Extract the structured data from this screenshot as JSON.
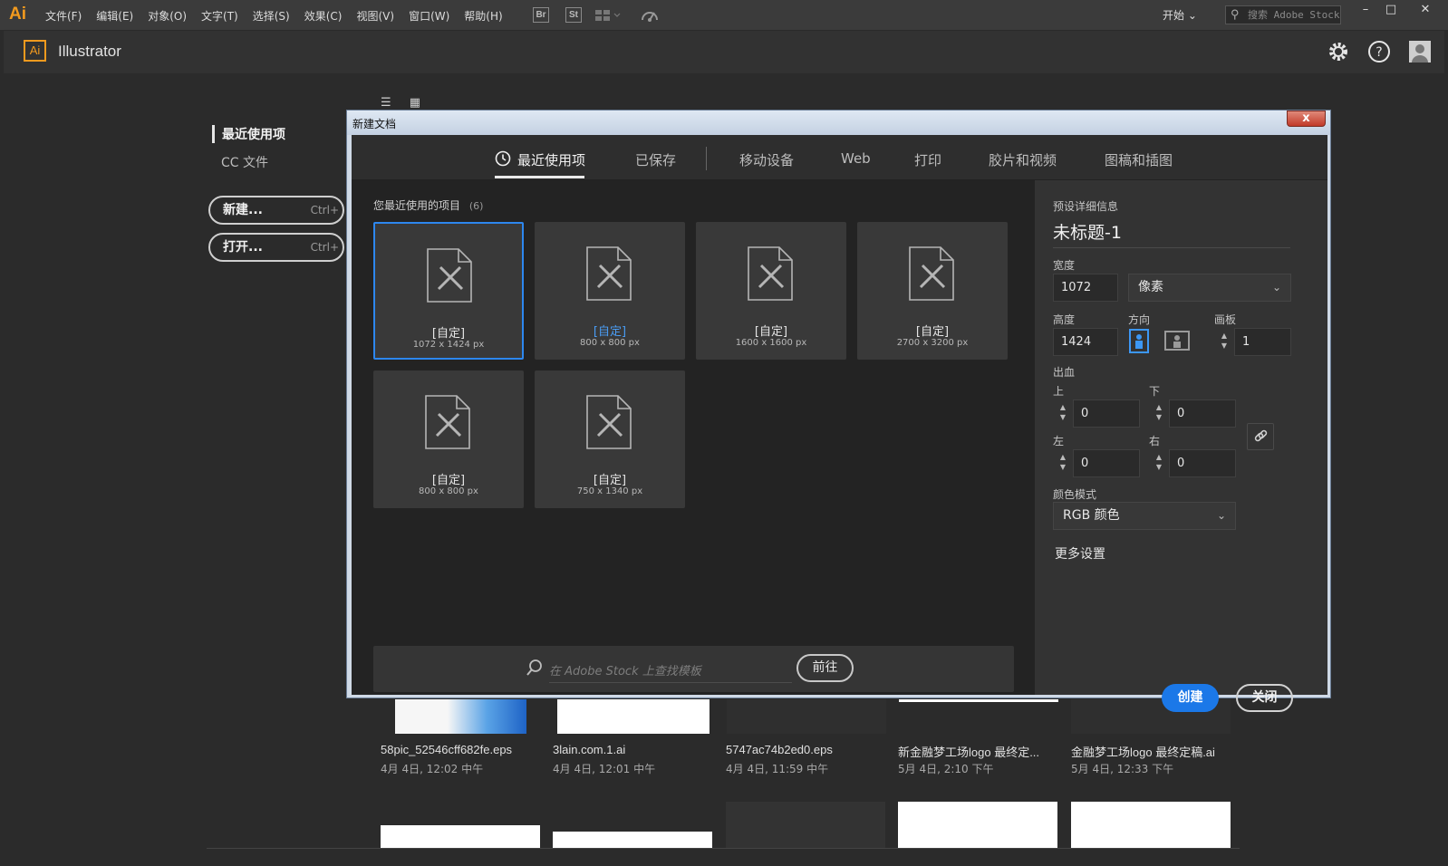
{
  "menubar": {
    "logo": "Ai",
    "items": [
      "文件(F)",
      "编辑(E)",
      "对象(O)",
      "文字(T)",
      "选择(S)",
      "效果(C)",
      "视图(V)",
      "窗口(W)",
      "帮助(H)"
    ],
    "bridge": "Br",
    "stock": "St",
    "workspace": "开始",
    "search_placeholder": "搜索 Adobe Stock"
  },
  "app": {
    "logo": "Ai",
    "name": "Illustrator"
  },
  "home": {
    "nav_recent": "最近使用项",
    "nav_cc": "CC 文件",
    "new_label": "新建...",
    "new_shortcut": "Ctrl+",
    "open_label": "打开...",
    "open_shortcut": "Ctrl+",
    "files": [
      {
        "name": "58pic_52546cff682fe.eps",
        "date": "4月 4日, 12:02 中午"
      },
      {
        "name": "3lain.com.1.ai",
        "date": "4月 4日, 12:01 中午"
      },
      {
        "name": "5747ac74b2ed0.eps",
        "date": "4月 4日, 11:59 中午"
      },
      {
        "name": "新金融梦工场logo 最终定...",
        "date": "5月 4日, 2:10 下午"
      },
      {
        "name": "金融梦工场logo 最终定稿.ai",
        "date": "5月 4日, 12:33 下午"
      }
    ]
  },
  "dialog": {
    "title": "新建文档",
    "close": "x",
    "tabs": [
      "最近使用项",
      "已保存",
      "移动设备",
      "Web",
      "打印",
      "胶片和视频",
      "图稿和插图"
    ],
    "recent_title": "您最近使用的项目",
    "recent_count": "(6)",
    "presets": [
      {
        "label": "[自定]",
        "size": "1072 x 1424 px"
      },
      {
        "label": "[自定]",
        "size": "800 x 800 px"
      },
      {
        "label": "[自定]",
        "size": "1600 x 1600 px"
      },
      {
        "label": "[自定]",
        "size": "2700 x 3200 px"
      },
      {
        "label": "[自定]",
        "size": "800 x 800 px"
      },
      {
        "label": "[自定]",
        "size": "750 x 1340 px"
      }
    ],
    "stock_placeholder": "在 Adobe Stock 上查找模板",
    "stock_go": "前往",
    "details": {
      "heading": "预设详细信息",
      "doc_name": "未标题-1",
      "width_label": "宽度",
      "width_value": "1072",
      "unit": "像素",
      "height_label": "高度",
      "height_value": "1424",
      "orientation_label": "方向",
      "artboards_label": "画板",
      "artboards_value": "1",
      "bleed_label": "出血",
      "top_label": "上",
      "top_value": "0",
      "bottom_label": "下",
      "bottom_value": "0",
      "left_label": "左",
      "left_value": "0",
      "right_label": "右",
      "right_value": "0",
      "color_mode_label": "颜色模式",
      "color_mode_value": "RGB 颜色",
      "more_settings": "更多设置",
      "create": "创建",
      "close": "关闭"
    }
  },
  "colors": {
    "accent": "#1b78e8",
    "ai_orange": "#f29a1e",
    "selected_border": "#2d87ef"
  }
}
